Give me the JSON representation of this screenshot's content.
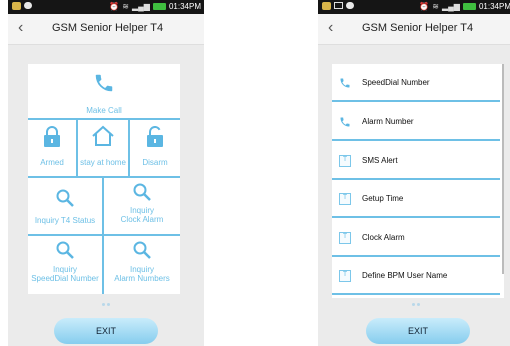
{
  "status": {
    "time": "01:34PM"
  },
  "left_screen": {
    "title": "GSM Senior Helper T4",
    "tiles": {
      "make_call": "Make Call",
      "armed": "Armed",
      "stay_home": "stay at home",
      "disarm": "Disarm",
      "inquiry_status": "Inquiry T4 Status",
      "inquiry_clock_1": "Inquiry",
      "inquiry_clock_2": "Clock Alarm",
      "inquiry_speed_1": "Inquiry",
      "inquiry_speed_2": "SpeedDial Number",
      "inquiry_alarm_1": "Inquiry",
      "inquiry_alarm_2": "Alarm Numbers"
    },
    "exit_label": "EXIT"
  },
  "right_screen": {
    "title": "GSM Senior Helper T4",
    "items": [
      {
        "label": "SpeedDial Number",
        "icon": "phone-icon"
      },
      {
        "label": "Alarm Number",
        "icon": "phone-icon"
      },
      {
        "label": "SMS Alert",
        "icon": "t-icon"
      },
      {
        "label": "Getup Time",
        "icon": "t-icon"
      },
      {
        "label": "Clock Alarm",
        "icon": "t-icon"
      },
      {
        "label": "Define BPM User Name",
        "icon": "t-icon"
      }
    ],
    "t_glyph": "T",
    "exit_label": "EXIT"
  },
  "colors": {
    "accent": "#6ec0e6",
    "background": "#ebebeb"
  }
}
